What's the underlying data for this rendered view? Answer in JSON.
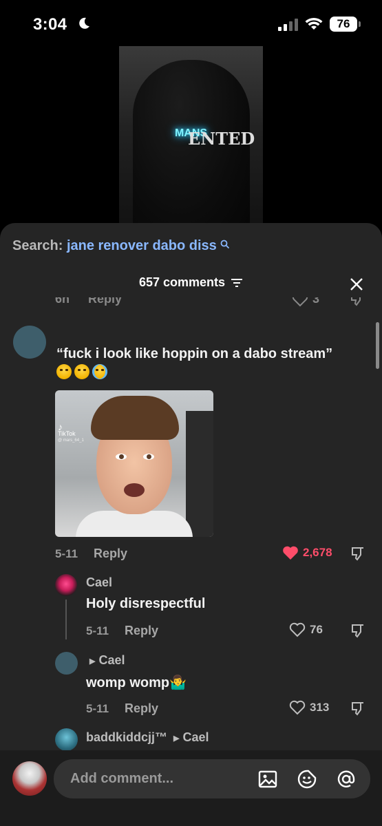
{
  "status_bar": {
    "time": "3:04",
    "battery": "76"
  },
  "video": {
    "overlay_text": "MANS",
    "shirt_text": "ENTED"
  },
  "search": {
    "label": "Search:",
    "query": "jane renover dabo diss"
  },
  "comments": {
    "header": "657 comments",
    "clipped_row": {
      "date": "6h",
      "reply_label": "Reply",
      "likes": "3"
    },
    "main_comment": {
      "text": "“fuck i look like hoppin on a dabo stream”",
      "emojis": [
        "weary-face",
        "weary-face",
        "loudly-crying-face"
      ],
      "video_watermark": {
        "brand": "TikTok",
        "handle": "@ mars_64_1"
      },
      "date": "5-11",
      "reply_label": "Reply",
      "likes": "2,678",
      "liked": true
    },
    "replies": [
      {
        "username": "Cael",
        "text": "Holy disrespectful",
        "date": "5-11",
        "reply_label": "Reply",
        "likes": "76"
      },
      {
        "username": "",
        "reply_to": "Cael",
        "text": "womp womp🤷‍♂️",
        "date": "5-11",
        "reply_label": "Reply",
        "likes": "313"
      },
      {
        "username": "baddkiddcjj™",
        "reply_to": "Cael"
      }
    ]
  },
  "composer": {
    "placeholder": "Add comment...",
    "icons": [
      "image-icon",
      "emoji-sticker-icon",
      "mention-icon"
    ]
  },
  "colors": {
    "accent_link": "#8ab8ff",
    "like_red": "#ff4d6a",
    "sheet_bg": "#252525"
  }
}
